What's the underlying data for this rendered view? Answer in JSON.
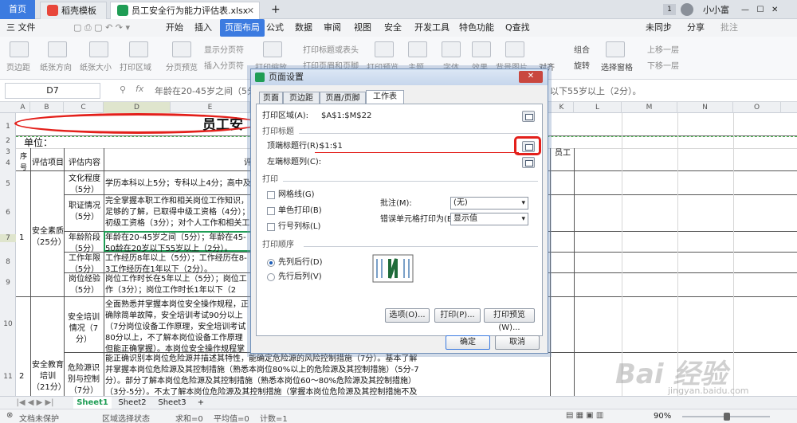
{
  "tabs": {
    "home": "首页",
    "template": "稻壳模板",
    "file": "员工安全行为能力评估表.xlsx",
    "add": "+"
  },
  "title_right": {
    "page": "1",
    "user": "小小富"
  },
  "menubar": {
    "file": "三 文件",
    "items": [
      "开始",
      "插入",
      "页面布局",
      "公式",
      "数据",
      "审阅",
      "视图",
      "安全",
      "开发工具",
      "特色功能"
    ],
    "search": "Q查找",
    "sync": "未同步",
    "share": "分享",
    "comment": "批注"
  },
  "ribbon": {
    "items": [
      "页边距",
      "纸张方向",
      "纸张大小",
      "打印区域",
      "分页预览",
      "显示分页符",
      "插入分页符",
      "打印缩放",
      "打印标题或表头",
      "打印页眉和页脚",
      "打印预览",
      "主题",
      "字体",
      "效果",
      "背景图片",
      "对齐",
      "组合",
      "旋转",
      "选择窗格",
      "上移一层",
      "下移一层"
    ]
  },
  "formula": {
    "cellref": "D7",
    "fx": "fx",
    "content": "年龄在20-45岁之间（5分）；年龄在45-50岁以及20岁以下55岁以上（2分）。",
    "tail": "以下55岁以上（2分）。"
  },
  "columns": [
    "A",
    "B",
    "C",
    "D",
    "E",
    "F",
    "G",
    "H",
    "I",
    "J",
    "K",
    "L",
    "M",
    "N",
    "O"
  ],
  "rows": [
    "1",
    "2",
    "3",
    "4",
    "5",
    "6",
    "7",
    "8",
    "9",
    "10",
    "11"
  ],
  "sheet": {
    "title": "员工安",
    "unit": "单位：",
    "hdr_no": "序号",
    "hdr_item": "评估项目",
    "hdr_content": "评估内容",
    "hdr_crit": "评",
    "hdr_staff": "员工",
    "cat1_no": "1",
    "cat1": "安全素质（25分）",
    "sub1": "文化程度（5分）",
    "d1": "学历本科以上5分；专科以上4分；高中及中",
    "sub2": "职证情况（5分）",
    "d2": "完全掌握本职工作和相关岗位工作知识，足够的了解，已取得中级工资格（4分）；初级工资格（3分）；对个人工作和相关工",
    "sub3": "年龄阶段（5分）",
    "d3": "年龄在20-45岁之间（5分）；年龄在45-50龄在20岁以下55岁以上（2分）。",
    "sub4": "工作年限（5分）",
    "d4": "工作经历8年以上（5分）；工作经历在8-3工作经历在1年以下（2分）。",
    "sub5": "岗位经验（5分）",
    "d5": "岗位工作时长在5年以上（5分）；岗位工作（3分）；岗位工作时长1年以下（2分）。",
    "sub6": "安全培训情况（7分）",
    "d6": "全面熟悉并掌握本岗位安全操作规程，正确除简单故障，安全培训考试90分以上（7分岗位设备工作原理，安全培训考试80分以上，不了解本岗位设备工作原理但能正确掌握）。本岗位安全操作规程掌握不全面或实",
    "cat2_no": "2",
    "cat2": "安全教育培训（21分）",
    "sub7": "危险源识别与控制（7分）",
    "d7": "能正确识别本岗位危险源并描述其特性，能确定危险源的风险控制措施（7分）。基本了解并掌握本岗位危险源及其控制措施（熟悉本岗位80%以上的危险源及其控制措施）（5分-7分）。部分了解本岗位危险源及其控制措施（熟悉本岗位60～80%危险源及其控制措施）（3分-5分）。不太了解本岗位危险源及其控制措施（掌握本岗位危险源及其控制措施不及60%）"
  },
  "dialog": {
    "title": "页面设置",
    "tabs": [
      "页面",
      "页边距",
      "页眉/页脚",
      "工作表"
    ],
    "print_area_label": "打印区域(A):",
    "print_area_value": "$A$1:$M$22",
    "print_titles": "打印标题",
    "top_rows_label": "顶端标题行(R):",
    "top_rows_value": "$1:$1",
    "left_cols_label": "左端标题列(C):",
    "print_section": "打印",
    "gridlines": "网格线(G)",
    "mono": "单色打印(B)",
    "rowcol": "行号列标(L)",
    "comments_label": "批注(M):",
    "comments_value": "(无)",
    "errors_label": "错误单元格打印为(E):",
    "errors_value": "显示值",
    "order_section": "打印顺序",
    "order_down": "先列后行(D)",
    "order_over": "先行后列(V)",
    "options_btn": "选项(O)...",
    "print_btn": "打印(P)...",
    "preview_btn": "打印预览(W)...",
    "ok_btn": "确定",
    "cancel_btn": "取消"
  },
  "sheettabs": [
    "Sheet1",
    "Sheet2",
    "Sheet3"
  ],
  "status": {
    "protect": "文档未保护",
    "region": "区域选择状态",
    "sum": "求和=0",
    "avg": "平均值=0",
    "count": "计数=1",
    "zoom": "90%"
  },
  "watermark": {
    "brand": "Bai 经验",
    "url": "jingyan.baidu.com"
  },
  "colors": {
    "accent": "#3c7be0",
    "annotation": "#e3201b",
    "sheet_tab": "#1f9d55"
  }
}
